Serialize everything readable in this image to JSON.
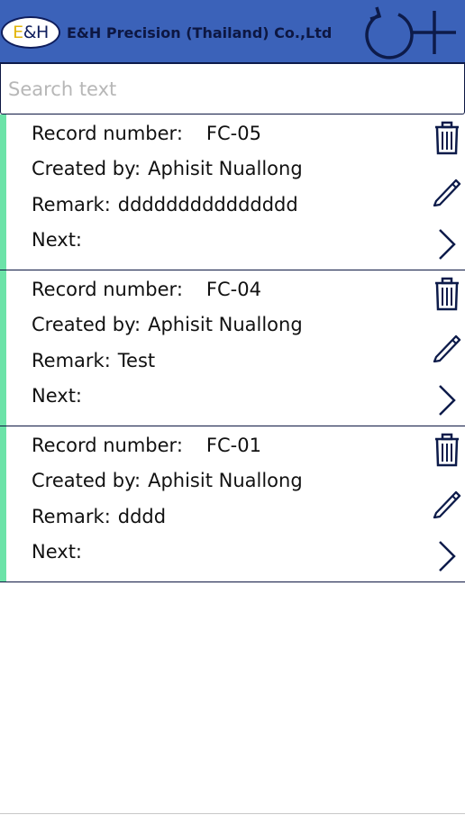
{
  "header": {
    "logo_text_e": "E",
    "logo_text_amp": "&",
    "logo_text_h": "H",
    "company_name": "E&H Precision (Thailand) Co.,Ltd",
    "colors": {
      "background": "#3b62b9",
      "icon": "#0d1b4a"
    },
    "icons": [
      "refresh-icon",
      "add-icon"
    ]
  },
  "search": {
    "value": "",
    "placeholder": "Search text"
  },
  "labels": {
    "record_number": "Record number:",
    "created_by": "Created by:",
    "remark": "Remark:",
    "next": "Next:"
  },
  "records": [
    {
      "record_number": "FC-05",
      "created_by": "Aphisit Nuallong",
      "remark": "ddddddddddddddd",
      "next": ""
    },
    {
      "record_number": "FC-04",
      "created_by": "Aphisit Nuallong",
      "remark": "Test",
      "next": ""
    },
    {
      "record_number": "FC-01",
      "created_by": "Aphisit Nuallong",
      "remark": "dddd",
      "next": ""
    }
  ],
  "row_icons": [
    "trash-icon",
    "pencil-icon",
    "chevron-right-icon"
  ],
  "accent_color": "#6ce3a8"
}
